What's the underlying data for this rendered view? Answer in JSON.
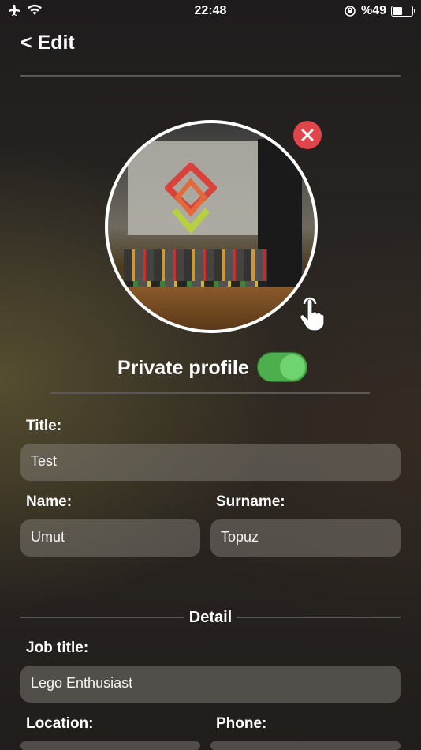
{
  "status": {
    "time": "22:48",
    "battery_text": "%49"
  },
  "header": {
    "title": "< Edit"
  },
  "profile": {
    "private_label": "Private profile",
    "private_enabled": true
  },
  "form": {
    "title_label": "Title:",
    "title_value": "Test",
    "name_label": "Name:",
    "name_value": "Umut",
    "surname_label": "Surname:",
    "surname_value": "Topuz",
    "detail_section": "Detail",
    "job_title_label": "Job title:",
    "job_title_value": "Lego Enthusiast",
    "location_label": "Location:",
    "phone_label": "Phone:"
  },
  "icons": [
    "airplane-icon",
    "wifi-icon",
    "orientation-lock-icon",
    "battery-icon",
    "close-icon",
    "tap-hand-icon"
  ],
  "colors": {
    "toggle_on": "#4cae4c",
    "remove_button": "#e0454a",
    "field_bg": "#6e6a62"
  }
}
